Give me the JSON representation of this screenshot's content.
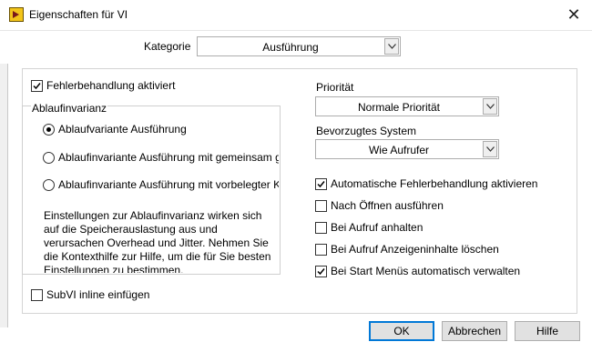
{
  "window": {
    "title": "Eigenschaften für VI",
    "close_glyph": "✕",
    "app_icon": "labview-vi-icon"
  },
  "category": {
    "label": "Kategorie",
    "value": "Ausführung"
  },
  "error_handling": {
    "label": "Fehlerbehandlung aktiviert",
    "checked": true
  },
  "reentrancy": {
    "group_label": "Ablaufinvarianz",
    "options": [
      {
        "label": "Ablaufvariante Ausführung",
        "selected": true
      },
      {
        "label": "Ablaufinvariante Ausführung mit gemeinsam g",
        "selected": false
      },
      {
        "label": "Ablaufinvariante Ausführung mit vorbelegter K",
        "selected": false
      }
    ],
    "info_text": "Einstellungen zur Ablaufinvarianz wirken sich auf die Speicherauslastung aus und verursachen Overhead und Jitter. Nehmen Sie die Kontexthilfe zur Hilfe, um die für Sie besten Einstellungen zu bestimmen."
  },
  "inline": {
    "label": "SubVI inline einfügen",
    "checked": false
  },
  "priority": {
    "label": "Priorität",
    "value": "Normale Priorität"
  },
  "preferred_system": {
    "label": "Bevorzugtes System",
    "value": "Wie Aufrufer"
  },
  "options_right": [
    {
      "label": "Automatische Fehlerbehandlung aktivieren",
      "checked": true
    },
    {
      "label": "Nach Öffnen ausführen",
      "checked": false
    },
    {
      "label": "Bei Aufruf anhalten",
      "checked": false
    },
    {
      "label": "Bei Aufruf Anzeigeninhalte löschen",
      "checked": false
    },
    {
      "label": "Bei Start Menüs automatisch verwalten",
      "checked": true
    }
  ],
  "buttons": {
    "ok": "OK",
    "cancel": "Abbrechen",
    "help": "Hilfe"
  },
  "colors": {
    "accent": "#0078d7",
    "icon_yellow": "#f3c51a"
  }
}
